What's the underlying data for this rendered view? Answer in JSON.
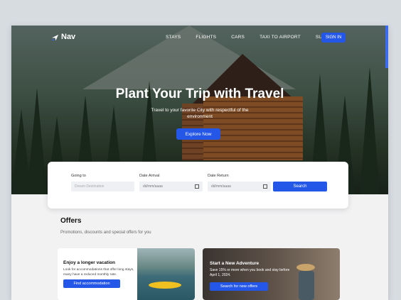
{
  "nav": {
    "logo_text": "Nav",
    "links": [
      "STAYS",
      "FLIGHTS",
      "CARS",
      "TAXI TO AIRPORT",
      "SUPPORT"
    ],
    "signin_label": "SIGN IN"
  },
  "hero": {
    "title": "Plant Your Trip with Travel",
    "subtitle": "Travel to your favorite City with respectful of the environment",
    "cta_label": "Explore Now"
  },
  "search": {
    "going_to_label": "Going to",
    "going_to_placeholder": "Dream Destination",
    "arrival_label": "Date Arrival",
    "arrival_value": "dd/mm/aaaa",
    "return_label": "Date Return",
    "return_value": "dd/mm/aaaa",
    "button_label": "Search"
  },
  "offers": {
    "title": "Offers",
    "subtitle": "Promotions, discounts and special offers for you",
    "cards": [
      {
        "title": "Enjoy a longer vacation",
        "text": "Look for accommodations that offer long stays, many have a reduced monthly rate.",
        "button": "Find accommodation"
      },
      {
        "title": "Start a New Adventure",
        "text": "Save 15% or more when you book and stay before April 1, 2024.",
        "button": "Search for new offers"
      }
    ]
  },
  "colors": {
    "accent": "#2457e8",
    "background": "#f2f2f3"
  }
}
